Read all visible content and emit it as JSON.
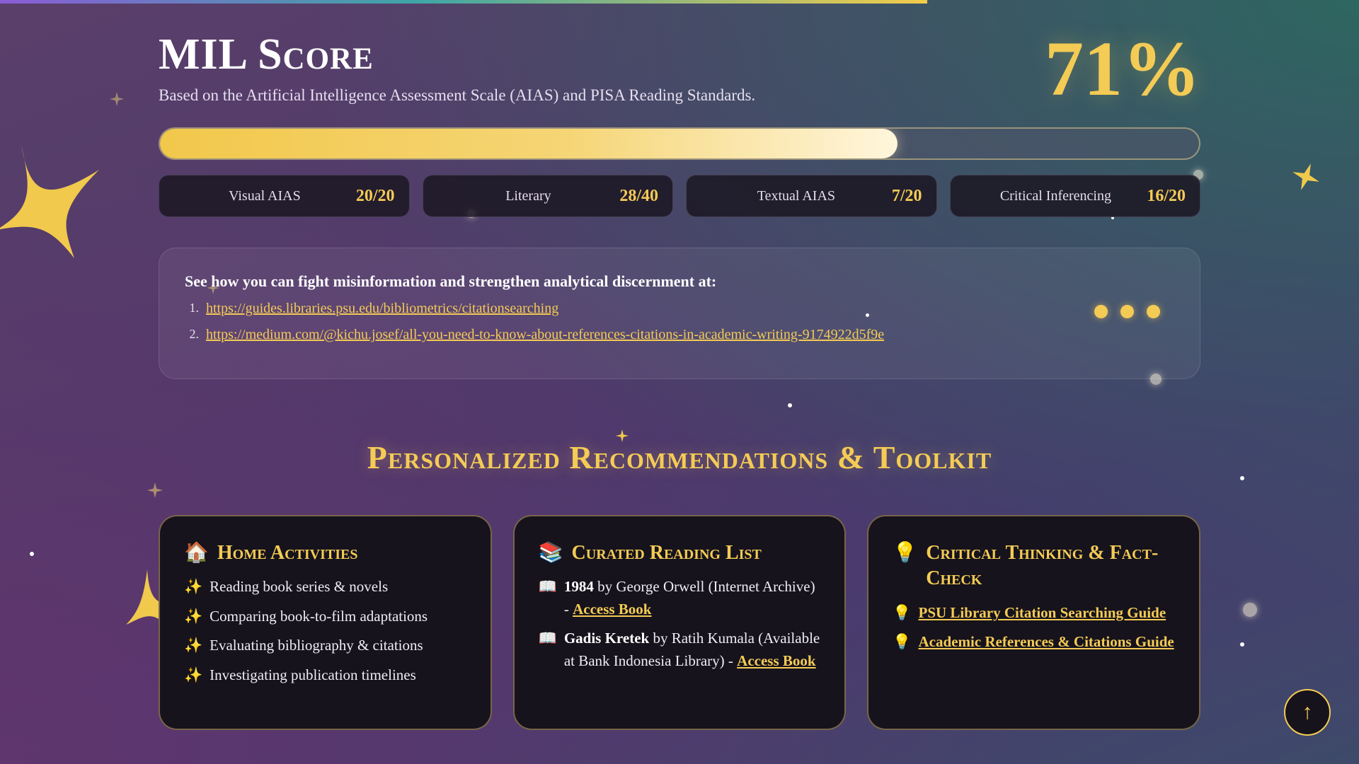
{
  "score": {
    "title": "MIL Score",
    "subtitle": "Based on the Artificial Intelligence Assessment Scale (AIAS) and PISA Reading Standards.",
    "percent": "71%",
    "progress_fraction": 0.71
  },
  "metrics": [
    {
      "label": "Visual AIAS",
      "value": "20/20"
    },
    {
      "label": "Literary",
      "value": "28/40"
    },
    {
      "label": "Textual AIAS",
      "value": "7/20"
    },
    {
      "label": "Critical Inferencing",
      "value": "16/20"
    }
  ],
  "info": {
    "title": "See how you can fight misinformation and strengthen analytical discernment at:",
    "links": [
      {
        "num": "1.",
        "url": "https://guides.libraries.psu.edu/bibliometrics/citationsearching"
      },
      {
        "num": "2.",
        "url": "https://medium.com/@kichu.josef/all-you-need-to-know-about-references-citations-in-academic-writing-9174922d5f9e"
      }
    ]
  },
  "recommendations": {
    "title": "Personalized Recommendations & Toolkit",
    "home": {
      "icon": "🏠",
      "title": "Home Activities",
      "items": [
        "Reading book series & novels",
        "Comparing book-to-film adaptations",
        "Evaluating bibliography & citations",
        "Investigating publication timelines"
      ],
      "item_icon": "✨"
    },
    "reading": {
      "icon": "📚",
      "title": "Curated Reading List",
      "item_icon": "📖",
      "book1_title": "1984",
      "book1_rest": " by George Orwell (Internet Archive) - ",
      "book1_link": "Access Book",
      "book2_title": "Gadis Kretek",
      "book2_rest": " by Ratih Kumala (Available at Bank Indonesia Library) - ",
      "book2_link": "Access Book"
    },
    "critical": {
      "icon": "💡",
      "title": "Critical Thinking & Fact-Check",
      "item_icon": "💡",
      "links": [
        "PSU Library Citation Searching Guide",
        "Academic References & Citations Guide"
      ]
    }
  },
  "scroll_top_icon": "↑",
  "colors": {
    "accent": "#f4cb55",
    "card_bg": "#16131c"
  }
}
